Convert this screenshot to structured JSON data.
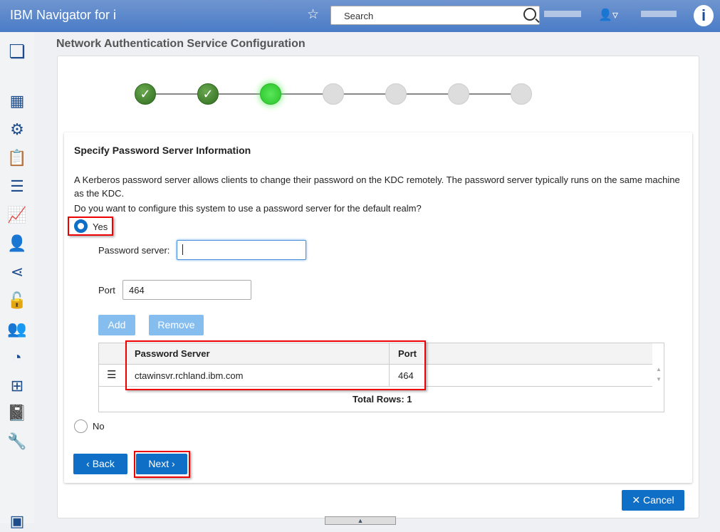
{
  "header": {
    "title": "IBM Navigator for i",
    "search_placeholder": "Search",
    "logo": "i"
  },
  "sidebar": {
    "icons": [
      "apps-icon",
      "building-icon",
      "gear-icon",
      "clipboard-icon",
      "list-icon",
      "chart-icon",
      "user-gear-icon",
      "network-icon",
      "lock-icon",
      "users-icon",
      "performance-icon",
      "hierarchy-icon",
      "journal-icon",
      "wrench-icon",
      "calendar-icon"
    ]
  },
  "page": {
    "title": "Network Authentication Service Configuration"
  },
  "wizard": {
    "steps": [
      "done",
      "done",
      "current",
      "pending",
      "pending",
      "pending",
      "pending"
    ]
  },
  "section": {
    "title": "Specify Password Server Information",
    "description": "A Kerberos password server allows clients to change their password on the KDC remotely. The password server typically runs on the same machine as the KDC.",
    "question": "Do you want to configure this system to use a password server for the default realm?",
    "yes_label": "Yes",
    "no_label": "No",
    "selected": "Yes",
    "password_server_label": "Password server:",
    "password_server_value": "",
    "port_label": "Port",
    "port_value": "464",
    "add_label": "Add",
    "remove_label": "Remove"
  },
  "table": {
    "columns": [
      "Password Server",
      "Port"
    ],
    "rows": [
      {
        "server": "ctawinsvr.rchland.ibm.com",
        "port": "464"
      }
    ],
    "total": "Total Rows: 1"
  },
  "footer": {
    "back": "Back",
    "next": "Next",
    "cancel": "Cancel"
  }
}
